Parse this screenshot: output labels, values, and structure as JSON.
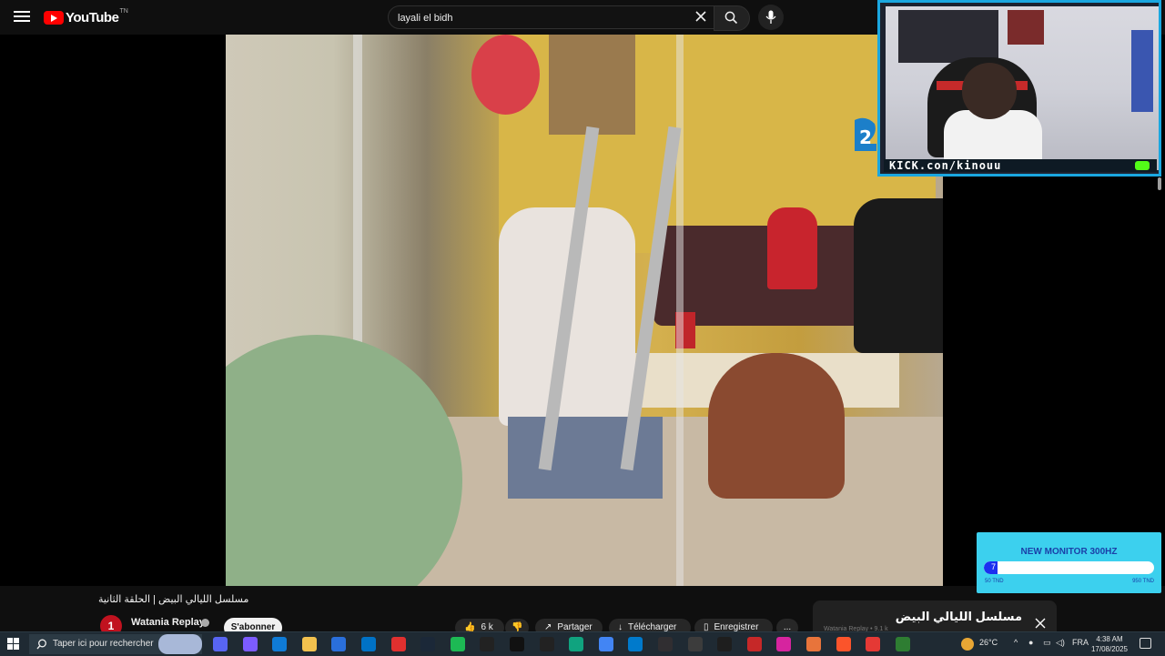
{
  "header": {
    "logo_text": "YouTube",
    "logo_tm": "TN",
    "search_value": "layali el bidh"
  },
  "overlay": {
    "kick_text": "KICK.con/kinouu"
  },
  "goal": {
    "title": "NEW MONITOR 300HZ",
    "current": "7",
    "progress_fraction": 0.08,
    "min_label": "50 TND",
    "max_label": "950 TND"
  },
  "video": {
    "title": "مسلسل الليالي البيض | الحلقة الثانية",
    "channel": "Watania Replay",
    "subscribe_label": "S'abonner",
    "likes": "6 k",
    "share_label": "Partager",
    "download_label": "Télécharger",
    "save_label": "Enregistrer",
    "more_label": "..."
  },
  "miniplayer": {
    "title": "مسلسل الليالي البيض",
    "subtitle": "Watania Replay • 9.1 k"
  },
  "taskbar": {
    "search_placeholder": "Taper ici pour rechercher",
    "weather": "26°C",
    "lang": "FRA",
    "time": "4:38 AM",
    "date": "17/08/2025"
  },
  "colors": {
    "accent_kick": "#53fc18",
    "cam_border": "#1aa7e0",
    "goal_bg": "#3cd0ee",
    "yt_red": "#ff0000"
  },
  "icons": {
    "taskbar": [
      "discord-icon",
      "copilot-icon",
      "edge-icon",
      "file-explorer-icon",
      "store-icon",
      "outlook-icon",
      "opera-icon",
      "steam-icon",
      "spotify-icon",
      "capcut-icon",
      "tiktok-icon",
      "capcut-alt-icon",
      "chatgpt-icon",
      "chrome-icon",
      "vscode-icon",
      "obs-icon",
      "settings-icon",
      "terminal-icon",
      "game-icon",
      "instagram-icon",
      "app-icon",
      "brave-icon",
      "record-icon",
      "maps-icon"
    ]
  }
}
